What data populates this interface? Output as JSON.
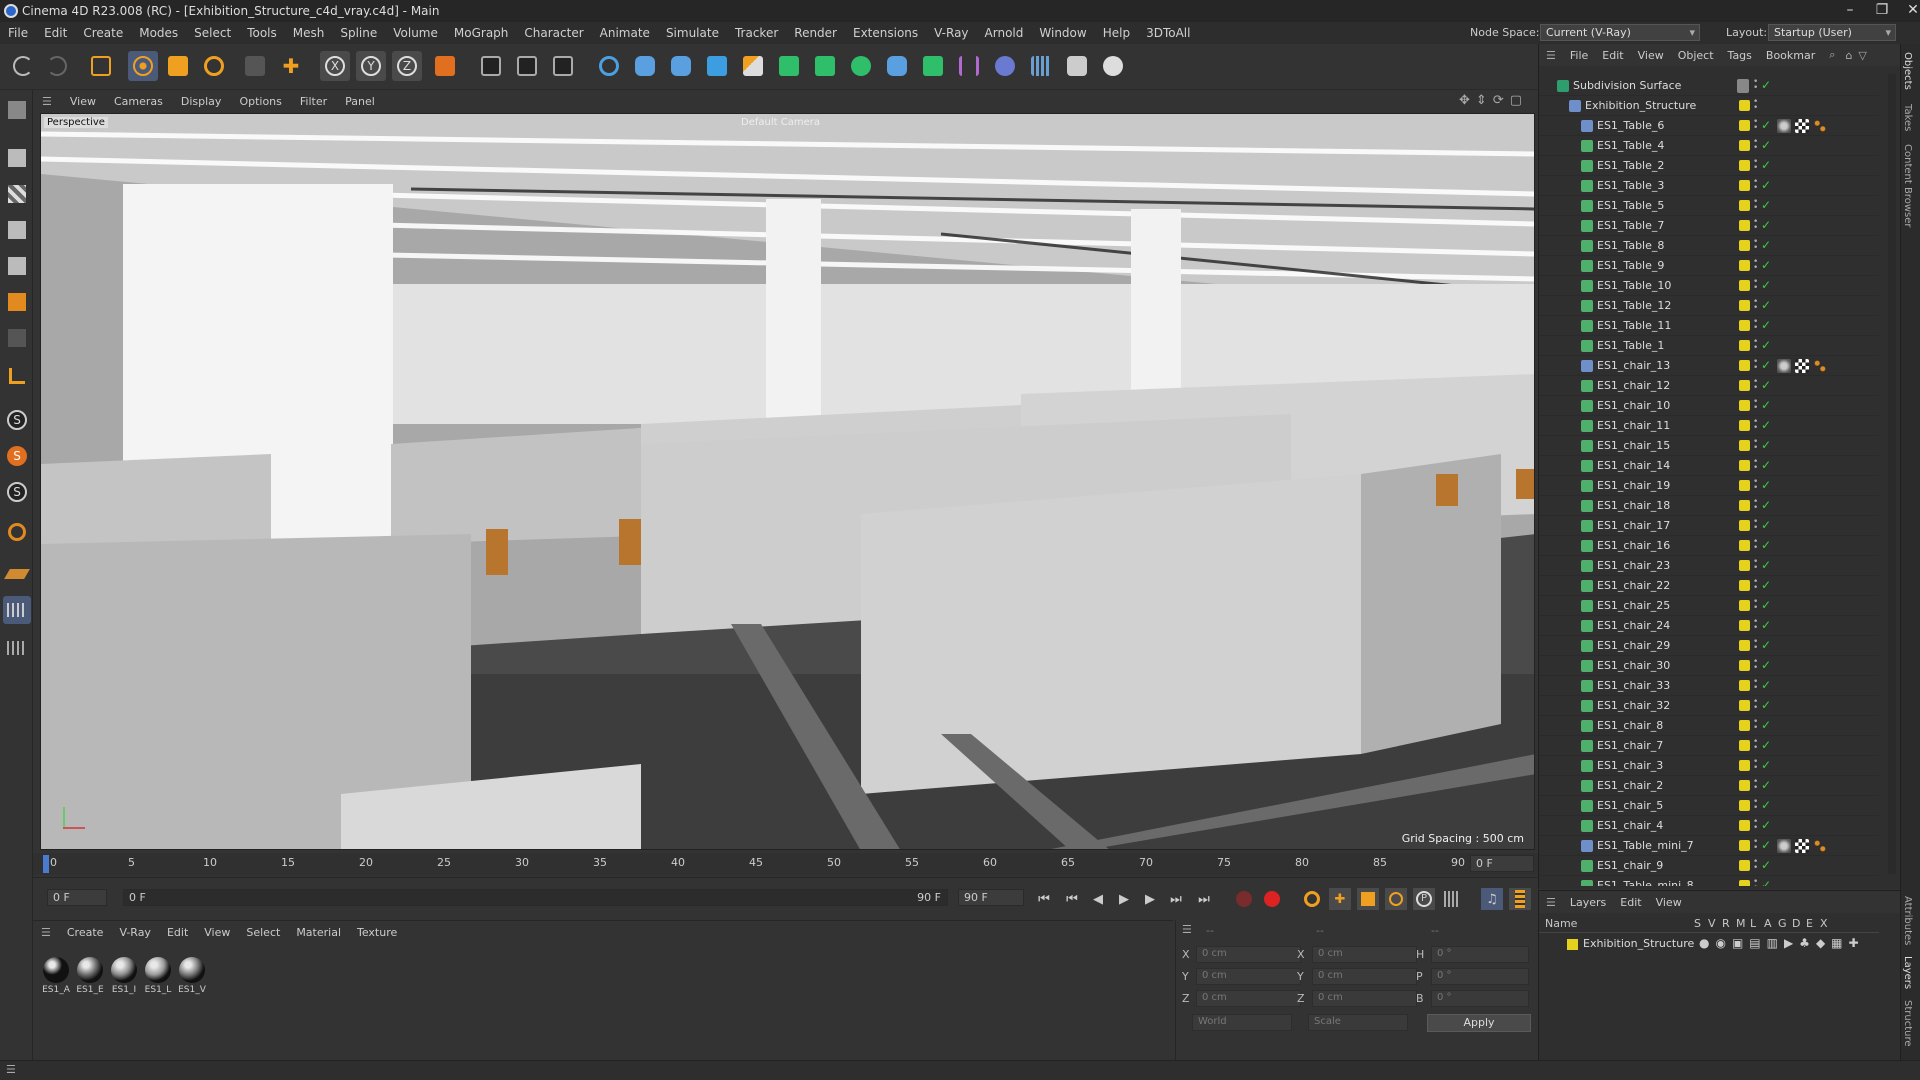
{
  "window": {
    "title": "Cinema 4D R23.008 (RC) - [Exhibition_Structure_c4d_vray.c4d] - Main"
  },
  "menu": [
    "File",
    "Edit",
    "Create",
    "Modes",
    "Select",
    "Tools",
    "Mesh",
    "Spline",
    "Volume",
    "MoGraph",
    "Character",
    "Animate",
    "Simulate",
    "Tracker",
    "Render",
    "Extensions",
    "V-Ray",
    "Arnold",
    "Window",
    "Help",
    "3DToAll"
  ],
  "nodespace": {
    "label": "Node Space:",
    "value": "Current (V-Ray)"
  },
  "layout": {
    "label": "Layout:",
    "value": "Startup (User)"
  },
  "viewport_menu": [
    "View",
    "Cameras",
    "Display",
    "Options",
    "Filter",
    "Panel"
  ],
  "viewport": {
    "view_name": "Perspective",
    "camera": "Default Camera",
    "grid_spacing": "Grid Spacing : 500 cm"
  },
  "timeline": {
    "ticks": [
      "0",
      "5",
      "10",
      "15",
      "20",
      "25",
      "30",
      "35",
      "40",
      "45",
      "50",
      "55",
      "60",
      "65",
      "70",
      "75",
      "80",
      "85",
      "90"
    ],
    "current": "0 F"
  },
  "transport": {
    "start": "0 F",
    "range_start": "0 F",
    "range_end": "90 F",
    "end": "90 F"
  },
  "material_menu": [
    "Create",
    "V-Ray",
    "Edit",
    "View",
    "Select",
    "Material",
    "Texture"
  ],
  "materials": [
    {
      "name": "ES1_A",
      "color": "#111111"
    },
    {
      "name": "ES1_E",
      "color": "#6f6f6f"
    },
    {
      "name": "ES1_I",
      "color": "#8c8c8c"
    },
    {
      "name": "ES1_L",
      "color": "#9a9a9a"
    },
    {
      "name": "ES1_V",
      "color": "#7a7a7a"
    }
  ],
  "coords": {
    "header_dashes": [
      "--",
      "--",
      "--"
    ],
    "rows": [
      {
        "label1": "X",
        "v1": "0 cm",
        "label2": "X",
        "v2": "0 cm",
        "label3": "H",
        "v3": "0 °"
      },
      {
        "label1": "Y",
        "v1": "0 cm",
        "label2": "Y",
        "v2": "0 cm",
        "label3": "P",
        "v3": "0 °"
      },
      {
        "label1": "Z",
        "v1": "0 cm",
        "label2": "Z",
        "v2": "0 cm",
        "label3": "B",
        "v3": "0 °"
      }
    ],
    "mode": "World",
    "scale": "Scale",
    "apply": "Apply"
  },
  "object_manager": {
    "menu": [
      "File",
      "Edit",
      "View",
      "Object",
      "Tags",
      "Bookmar"
    ],
    "rows": [
      {
        "name": "Subdivision Surface",
        "indent": 0,
        "icon": "#2f9e6e",
        "tags": false
      },
      {
        "name": "Exhibition_Structure",
        "indent": 1,
        "icon": "#6e8fc9",
        "tags": false
      },
      {
        "name": "ES1_Table_6",
        "indent": 2,
        "icon": "#6e8fc9",
        "tags": true
      },
      {
        "name": "ES1_Table_4",
        "indent": 2,
        "icon": "#4fb06b",
        "tags": false
      },
      {
        "name": "ES1_Table_2",
        "indent": 2,
        "icon": "#4fb06b",
        "tags": false
      },
      {
        "name": "ES1_Table_3",
        "indent": 2,
        "icon": "#4fb06b",
        "tags": false
      },
      {
        "name": "ES1_Table_5",
        "indent": 2,
        "icon": "#4fb06b",
        "tags": false
      },
      {
        "name": "ES1_Table_7",
        "indent": 2,
        "icon": "#4fb06b",
        "tags": false
      },
      {
        "name": "ES1_Table_8",
        "indent": 2,
        "icon": "#4fb06b",
        "tags": false
      },
      {
        "name": "ES1_Table_9",
        "indent": 2,
        "icon": "#4fb06b",
        "tags": false
      },
      {
        "name": "ES1_Table_10",
        "indent": 2,
        "icon": "#4fb06b",
        "tags": false
      },
      {
        "name": "ES1_Table_12",
        "indent": 2,
        "icon": "#4fb06b",
        "tags": false
      },
      {
        "name": "ES1_Table_11",
        "indent": 2,
        "icon": "#4fb06b",
        "tags": false
      },
      {
        "name": "ES1_Table_1",
        "indent": 2,
        "icon": "#4fb06b",
        "tags": false
      },
      {
        "name": "ES1_chair_13",
        "indent": 2,
        "icon": "#6e8fc9",
        "tags": true
      },
      {
        "name": "ES1_chair_12",
        "indent": 2,
        "icon": "#4fb06b",
        "tags": false
      },
      {
        "name": "ES1_chair_10",
        "indent": 2,
        "icon": "#4fb06b",
        "tags": false
      },
      {
        "name": "ES1_chair_11",
        "indent": 2,
        "icon": "#4fb06b",
        "tags": false
      },
      {
        "name": "ES1_chair_15",
        "indent": 2,
        "icon": "#4fb06b",
        "tags": false
      },
      {
        "name": "ES1_chair_14",
        "indent": 2,
        "icon": "#4fb06b",
        "tags": false
      },
      {
        "name": "ES1_chair_19",
        "indent": 2,
        "icon": "#4fb06b",
        "tags": false
      },
      {
        "name": "ES1_chair_18",
        "indent": 2,
        "icon": "#4fb06b",
        "tags": false
      },
      {
        "name": "ES1_chair_17",
        "indent": 2,
        "icon": "#4fb06b",
        "tags": false
      },
      {
        "name": "ES1_chair_16",
        "indent": 2,
        "icon": "#4fb06b",
        "tags": false
      },
      {
        "name": "ES1_chair_23",
        "indent": 2,
        "icon": "#4fb06b",
        "tags": false
      },
      {
        "name": "ES1_chair_22",
        "indent": 2,
        "icon": "#4fb06b",
        "tags": false
      },
      {
        "name": "ES1_chair_25",
        "indent": 2,
        "icon": "#4fb06b",
        "tags": false
      },
      {
        "name": "ES1_chair_24",
        "indent": 2,
        "icon": "#4fb06b",
        "tags": false
      },
      {
        "name": "ES1_chair_29",
        "indent": 2,
        "icon": "#4fb06b",
        "tags": false
      },
      {
        "name": "ES1_chair_30",
        "indent": 2,
        "icon": "#4fb06b",
        "tags": false
      },
      {
        "name": "ES1_chair_33",
        "indent": 2,
        "icon": "#4fb06b",
        "tags": false
      },
      {
        "name": "ES1_chair_32",
        "indent": 2,
        "icon": "#4fb06b",
        "tags": false
      },
      {
        "name": "ES1_chair_8",
        "indent": 2,
        "icon": "#4fb06b",
        "tags": false
      },
      {
        "name": "ES1_chair_7",
        "indent": 2,
        "icon": "#4fb06b",
        "tags": false
      },
      {
        "name": "ES1_chair_3",
        "indent": 2,
        "icon": "#4fb06b",
        "tags": false
      },
      {
        "name": "ES1_chair_2",
        "indent": 2,
        "icon": "#4fb06b",
        "tags": false
      },
      {
        "name": "ES1_chair_5",
        "indent": 2,
        "icon": "#4fb06b",
        "tags": false
      },
      {
        "name": "ES1_chair_4",
        "indent": 2,
        "icon": "#4fb06b",
        "tags": false
      },
      {
        "name": "ES1_Table_mini_7",
        "indent": 2,
        "icon": "#6e8fc9",
        "tags": true
      },
      {
        "name": "ES1_chair_9",
        "indent": 2,
        "icon": "#4fb06b",
        "tags": false
      },
      {
        "name": "ES1_Table_mini_8",
        "indent": 2,
        "icon": "#4fb06b",
        "tags": false
      }
    ]
  },
  "layers": {
    "menu": [
      "Layers",
      "Edit",
      "View"
    ],
    "header": {
      "name": "Name",
      "cols": [
        "S",
        "V",
        "R",
        "M",
        "L",
        "A",
        "G",
        "D",
        "E",
        "X"
      ]
    },
    "rows": [
      {
        "name": "Exhibition_Structure",
        "color": "#e6d21c"
      }
    ]
  },
  "side_tabs": [
    "Objects",
    "Takes",
    "Content Browser",
    "Attributes",
    "Layers",
    "Structure"
  ]
}
